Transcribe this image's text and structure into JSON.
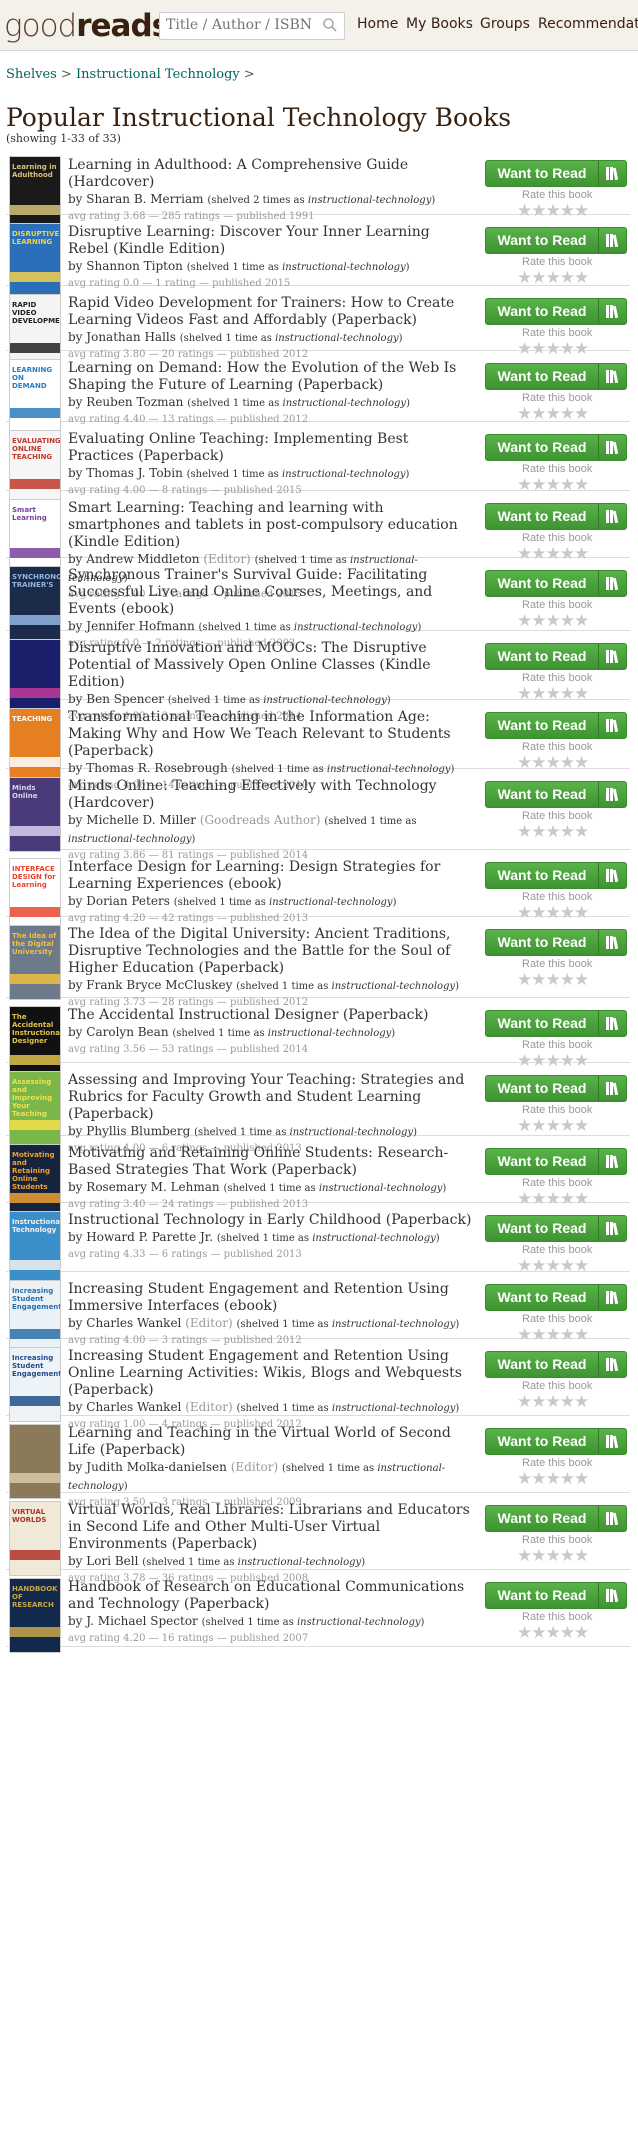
{
  "header": {
    "logo_light": "good",
    "logo_bold": "reads",
    "search_placeholder": "Title / Author / ISBN",
    "nav": [
      "Home",
      "My Books",
      "Groups",
      "Recommendations"
    ]
  },
  "breadcrumb": {
    "shelves": "Shelves",
    "sep1": " > ",
    "current": "Instructional Technology",
    "sep2": " >"
  },
  "page_title": "Popular Instructional Technology Books",
  "showing": "(showing 1-33 of 33)",
  "labels": {
    "by": "by",
    "want_to_read": "Want to Read",
    "rate_this": "Rate this book",
    "stars": "★★★★★",
    "shelf_tag": "instructional-technology"
  },
  "colors": {
    "button_green": "#409D35",
    "title_brown": "#382110",
    "link_teal": "#00635d",
    "muted": "#999999"
  },
  "books": [
    {
      "title": "Learning in Adulthood: A Comprehensive Guide (Hardcover)",
      "author": "Sharan B. Merriam",
      "role": "",
      "shelved": "(shelved 2 times as ",
      "stats": "avg rating 3.68 — 285 ratings — published 1991",
      "cover": "#1a1a1a",
      "accent": "#d8c27a",
      "cover_text": "Learning in Adulthood"
    },
    {
      "title": "Disruptive Learning: Discover Your Inner Learning Rebel (Kindle Edition)",
      "author": "Shannon Tipton",
      "role": "",
      "shelved": "(shelved 1 time as ",
      "stats": "avg rating 0.0 — 1 rating — published 2015",
      "cover": "#2a6fb8",
      "accent": "#f2d04a",
      "cover_text": "DISRUPTIVE LEARNING"
    },
    {
      "title": "Rapid Video Development for Trainers: How to Create Learning Videos Fast and Affordably (Paperback)",
      "author": "Jonathan Halls",
      "role": "",
      "shelved": "(shelved 1 time as ",
      "stats": "avg rating 3.80 — 20 ratings — published 2012",
      "cover": "#f4f4f4",
      "accent": "#222222",
      "cover_text": "RAPID VIDEO DEVELOPMENT"
    },
    {
      "title": "Learning on Demand: How the Evolution of the Web Is Shaping the Future of Learning (Paperback)",
      "author": "Reuben Tozman",
      "role": "",
      "shelved": "(shelved 1 time as ",
      "stats": "avg rating 4.40 — 13 ratings — published 2012",
      "cover": "#ffffff",
      "accent": "#2a7ec0",
      "cover_text": "LEARNING ON DEMAND"
    },
    {
      "title": "Evaluating Online Teaching: Implementing Best Practices (Paperback)",
      "author": "Thomas J. Tobin",
      "role": "",
      "shelved": "(shelved 1 time as ",
      "stats": "avg rating 4.00 — 8 ratings — published 2015",
      "cover": "#f6f6f6",
      "accent": "#c0392b",
      "cover_text": "EVALUATING ONLINE TEACHING"
    },
    {
      "title": "Smart Learning: Teaching and learning with smartphones and tablets in post-compulsory education (Kindle Edition)",
      "author": "Andrew Middleton",
      "role": "(Editor)",
      "shelved": "(shelved 1 time as ",
      "stats": "avg rating 3.00 — 2 ratings — published 2015",
      "cover": "#ffffff",
      "accent": "#7a3f9e",
      "cover_text": "Smart Learning"
    },
    {
      "title": "Synchronous Trainer's Survival Guide: Facilitating Successful Live and Online Courses, Meetings, and Events (ebook)",
      "author": "Jennifer Hofmann",
      "role": "",
      "shelved": "(shelved 1 time as ",
      "stats": "avg rating 0.0 — 2 ratings — published 2003",
      "cover": "#1c2b4a",
      "accent": "#8fb5e0",
      "cover_text": "SYNCHRONOUS TRAINER'S"
    },
    {
      "title": "Disruptive Innovation and MOOCs: The Disruptive Potential of Massively Open Online Classes (Kindle Edition)",
      "author": "Ben Spencer",
      "role": "",
      "shelved": "(shelved 1 time as ",
      "stats": "avg rating 4.00 — 3 ratings — published 2014",
      "cover": "#1a1f6b",
      "accent": "#c23b9b",
      "cover_text": ""
    },
    {
      "title": "Transformational Teaching in the Information Age: Making Why and How We Teach Relevant to Students (Paperback)",
      "author": "Thomas R. Rosebrough",
      "role": "",
      "shelved": "(shelved 1 time as ",
      "stats": "avg rating 4.00 — 14 ratings — published 2010",
      "cover": "#e67e22",
      "accent": "#ffffff",
      "cover_text": "TEACHING"
    },
    {
      "title": "Minds Online: Teaching Effectively with Technology (Hardcover)",
      "author": "Michelle D. Miller",
      "role": "(Goodreads Author)",
      "shelved": "(shelved 1 time as ",
      "stats": "avg rating 3.86 — 81 ratings — published 2014",
      "cover": "#4a3a7a",
      "accent": "#d8d0f0",
      "cover_text": "Minds Online"
    },
    {
      "title": "Interface Design for Learning: Design Strategies for Learning Experiences (ebook)",
      "author": "Dorian Peters",
      "role": "",
      "shelved": "(shelved 1 time as ",
      "stats": "avg rating 4.20 — 42 ratings — published 2013",
      "cover": "#ffffff",
      "accent": "#e8462f",
      "cover_text": "INTERFACE DESIGN for Learning"
    },
    {
      "title": "The Idea of the Digital University: Ancient Traditions, Disruptive Technologies and the Battle for the Soul of Higher Education (Paperback)",
      "author": "Frank Bryce McCluskey",
      "role": "",
      "shelved": "(shelved 1 time as ",
      "stats": "avg rating 3.73 — 28 ratings — published 2012",
      "cover": "#6c7a89",
      "accent": "#f0c040",
      "cover_text": "The Idea of the Digital University"
    },
    {
      "title": "The Accidental Instructional Designer (Paperback)",
      "author": "Carolyn Bean",
      "role": "",
      "shelved": "(shelved 1 time as ",
      "stats": "avg rating 3.56 — 53 ratings — published 2014",
      "cover": "#111111",
      "accent": "#e0c24a",
      "cover_text": "The Accidental Instructional Designer"
    },
    {
      "title": "Assessing and Improving Your Teaching: Strategies and Rubrics for Faculty Growth and Student Learning (Paperback)",
      "author": "Phyllis Blumberg",
      "role": "",
      "shelved": "(shelved 1 time as ",
      "stats": "avg rating 4.00 — 6 ratings — published 2013",
      "cover": "#7ab648",
      "accent": "#f5e04a",
      "cover_text": "Assessing and Improving Your Teaching"
    },
    {
      "title": "Motivating and Retaining Online Students: Research-Based Strategies That Work (Paperback)",
      "author": "Rosemary M. Lehman",
      "role": "",
      "shelved": "(shelved 1 time as ",
      "stats": "avg rating 3.40 — 24 ratings — published 2013",
      "cover": "#16233d",
      "accent": "#f0a030",
      "cover_text": "Motivating and Retaining Online Students"
    },
    {
      "title": "Instructional Technology in Early Childhood (Paperback)",
      "author": "Howard P. Parette Jr.",
      "role": "",
      "shelved": "(shelved 1 time as ",
      "stats": "avg rating 4.33 — 6 ratings — published 2013",
      "cover": "#3a8fc8",
      "accent": "#f2f2f2",
      "cover_text": "Instructional Technology"
    },
    {
      "title": "Increasing Student Engagement and Retention Using Immersive Interfaces (ebook)",
      "author": "Charles Wankel",
      "role": "(Editor)",
      "shelved": "(shelved 1 time as ",
      "stats": "avg rating 4.00 — 3 ratings — published 2012",
      "cover": "#eaf1f7",
      "accent": "#2a6fa8",
      "cover_text": "Increasing Student Engagement"
    },
    {
      "title": "Increasing Student Engagement and Retention Using Online Learning Activities: Wikis, Blogs and Webquests (Paperback)",
      "author": "Charles Wankel",
      "role": "(Editor)",
      "shelved": "(shelved 1 time as ",
      "stats": "avg rating 1.00 — 4 ratings — published 2012",
      "cover": "#eef3f8",
      "accent": "#1f4e8a",
      "cover_text": "Increasing Student Engagement"
    },
    {
      "title": "Learning and Teaching in the Virtual World of Second Life (Paperback)",
      "author": "Judith Molka-danielsen",
      "role": "(Editor)",
      "shelved": "(shelved 1 time as ",
      "stats": "avg rating 3.50 — 3 ratings — published 2009",
      "cover": "#8a7a5a",
      "accent": "#d9c9a9",
      "cover_text": ""
    },
    {
      "title": "Virtual Worlds, Real Libraries: Librarians and Educators in Second Life and Other Multi-User Virtual Environments (Paperback)",
      "author": "Lori Bell",
      "role": "",
      "shelved": "(shelved 1 time as ",
      "stats": "avg rating 3.78 — 36 ratings — published 2008",
      "cover": "#f1e9d8",
      "accent": "#b0302a",
      "cover_text": "VIRTUAL WORLDS"
    },
    {
      "title": "Handbook of Research on Educational Communications and Technology (Paperback)",
      "author": "J. Michael Spector",
      "role": "",
      "shelved": "(shelved 1 time as ",
      "stats": "avg rating 4.20 — 16 ratings — published 2007",
      "cover": "#13294b",
      "accent": "#c9a64a",
      "cover_text": "HANDBOOK OF RESEARCH"
    }
  ]
}
